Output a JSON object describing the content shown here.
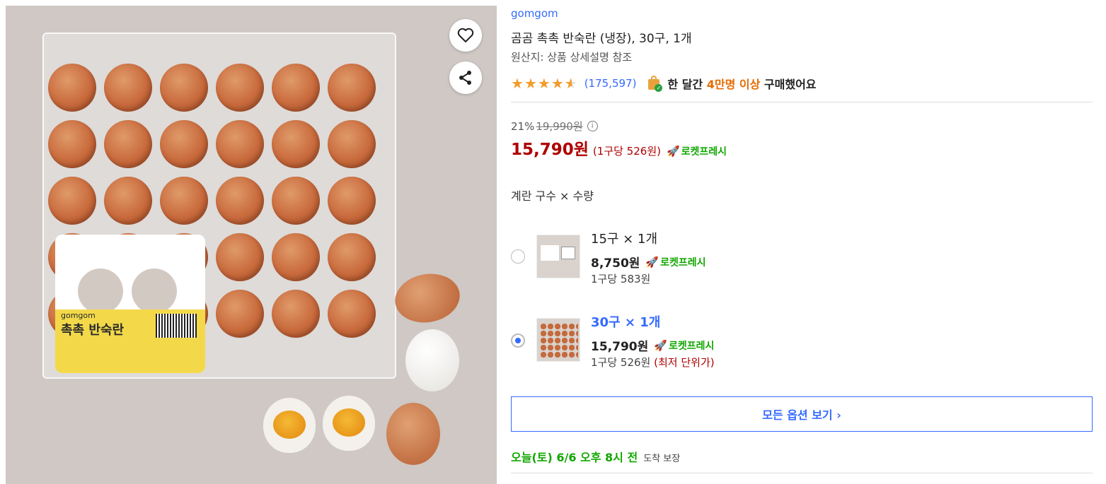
{
  "product_image": {
    "label_brand": "gomgom",
    "label_name": "촉촉 반숙란"
  },
  "product": {
    "brand": "gomgom",
    "title": "곰곰 촉촉 반숙란 (냉장), 30구, 1개",
    "origin": "원산지: 상품 상세설명 참조",
    "rating": 4.5,
    "review_count": "(175,597)",
    "purchase_prefix": "한 달간",
    "purchase_highlight": "4만명 이상",
    "purchase_suffix": "구매했어요"
  },
  "pricing": {
    "discount_rate": "21%",
    "original_price": "19,990원",
    "sale_price": "15,790원",
    "unit_price": "(1구당 526원)",
    "rocket_label": "로켓프레시"
  },
  "options": {
    "label": "계란 구수 × 수량",
    "items": [
      {
        "name": "15구 × 1개",
        "price": "8,750원",
        "rocket_label": "로켓프레시",
        "unit": "1구당 583원",
        "lowest_note": "",
        "selected": false
      },
      {
        "name": "30구 × 1개",
        "price": "15,790원",
        "rocket_label": "로켓프레시",
        "unit": "1구당 526원",
        "lowest_note": "(최저 단위가)",
        "selected": true
      }
    ],
    "view_all": "모든 옵션 보기 ›"
  },
  "delivery": {
    "date_text": "오늘(토) 6/6 오후 8시 전",
    "guarantee_text": "도착 보장"
  },
  "colors": {
    "brand_blue": "#346aff",
    "price_red": "#ae0000",
    "rocket_green": "#11a700",
    "highlight_orange": "#e56b00",
    "star": "#f39c2c"
  },
  "icons": [
    "heart-icon",
    "share-icon",
    "star-icon",
    "shopping-bag-check-icon",
    "info-icon",
    "rocket-icon",
    "chevron-right-icon"
  ]
}
